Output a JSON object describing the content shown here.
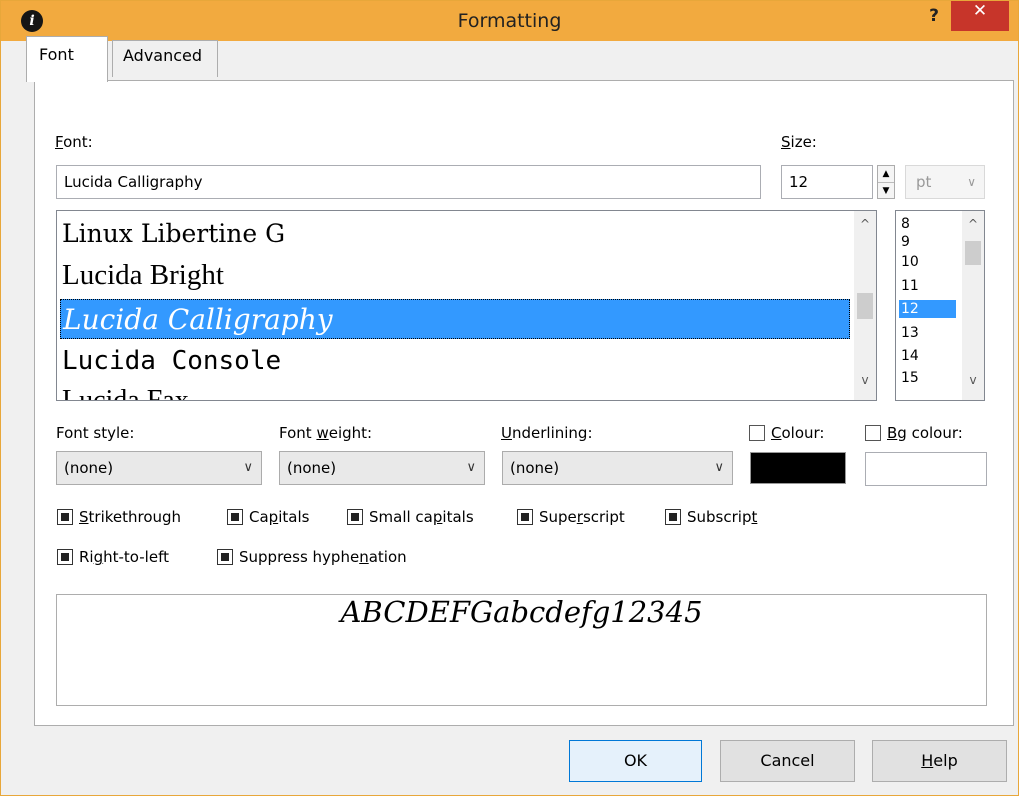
{
  "window": {
    "title": "Formatting",
    "help_label": "?",
    "close_label": "✕",
    "app_icon_glyph": "i"
  },
  "tabs": [
    {
      "label": "Font"
    },
    {
      "label": "Advanced"
    }
  ],
  "font": {
    "label_prefix": "",
    "label_mnemonic": "F",
    "label_rest": "ont:",
    "value": "Lucida Calligraphy",
    "list": [
      {
        "name": "Linux Libertine G"
      },
      {
        "name": "Lucida Bright"
      },
      {
        "name": "Lucida Calligraphy"
      },
      {
        "name": "Lucida Console"
      },
      {
        "name": "Lucida Fax"
      }
    ]
  },
  "size": {
    "label_mnemonic": "S",
    "label_rest": "ize:",
    "value": "12",
    "unit": "pt",
    "list": [
      "8",
      "9",
      "10",
      "11",
      "12",
      "13",
      "14",
      "15"
    ],
    "selected": "12"
  },
  "font_style": {
    "label": "Font style:",
    "value": "(none)"
  },
  "font_weight": {
    "label_prefix": "Font ",
    "label_mnemonic": "w",
    "label_rest": "eight:",
    "value": "(none)"
  },
  "underlining": {
    "label_mnemonic": "U",
    "label_rest": "nderlining:",
    "value": "(none)"
  },
  "colour": {
    "label_mnemonic": "C",
    "label_rest": "olour:",
    "swatch": "#000000"
  },
  "bg_colour": {
    "label_mnemonic": "B",
    "label_rest": "g colour:",
    "swatch": "#ffffff"
  },
  "checks_row1": [
    {
      "pre": "",
      "mn": "S",
      "post": "trikethrough"
    },
    {
      "pre": "Ca",
      "mn": "p",
      "post": "itals"
    },
    {
      "pre": "Small ca",
      "mn": "p",
      "post": "itals"
    },
    {
      "pre": "Supe",
      "mn": "r",
      "post": "script"
    },
    {
      "pre": "Subscrip",
      "mn": "t",
      "post": ""
    }
  ],
  "checks_row2": [
    {
      "pre": "Ri",
      "mn": "g",
      "post": "ht-to-left"
    },
    {
      "pre": "Suppress hyphe",
      "mn": "n",
      "post": "ation"
    }
  ],
  "preview_text": "ABCDEFGabcdefg12345",
  "buttons": {
    "ok": "OK",
    "cancel": "Cancel",
    "help_mn": "H",
    "help_rest": "elp"
  }
}
